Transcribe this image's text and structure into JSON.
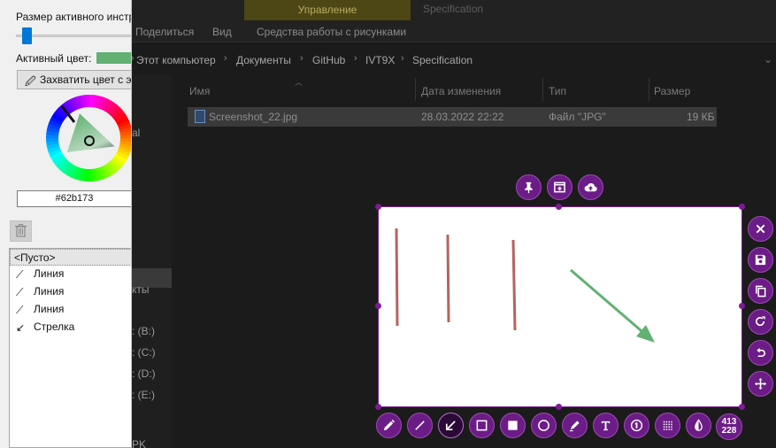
{
  "explorer": {
    "manage_tab": "Управление",
    "window_title": "Specification",
    "ribbon": {
      "share": "Поделиться",
      "view": "Вид",
      "picture_tools": "Средства работы с рисунками"
    },
    "breadcrumb": [
      "Этот компьютер",
      "Документы",
      "GitHub",
      "IVT9X",
      "Specification"
    ],
    "columns": {
      "name": "Имя",
      "date": "Дата изменения",
      "type": "Тип",
      "size": "Размер"
    },
    "file": {
      "name": "Screenshot_22.jpg",
      "date": "28.03.2022 22:22",
      "type": "Файл \"JPG\"",
      "size": "19 КБ"
    },
    "nav_fragments": [
      "al",
      "кты",
      ": (B:)",
      ": (C:)",
      ": (D:)",
      ": (E:)",
      "PK"
    ]
  },
  "panel": {
    "tool_size_label": "Размер активного инструмента",
    "active_color_label": "Активный цвет:",
    "active_color": "#62b173",
    "pick_button": "Захватить цвет с экрана",
    "hex_value": "#62b173",
    "history": [
      {
        "label": "<Пусто>",
        "icon": "none",
        "selected": true
      },
      {
        "label": "Линия",
        "icon": "line-icon"
      },
      {
        "label": "Линия",
        "icon": "line-icon"
      },
      {
        "label": "Линия",
        "icon": "line-icon"
      },
      {
        "label": "Стрелка",
        "icon": "arrow-icon"
      }
    ]
  },
  "capture": {
    "width": "413",
    "height": "228",
    "accent": "#6c1c86",
    "line_color": "#b5645e",
    "arrow_color": "#62b173"
  },
  "toolbar_top": [
    "pin-icon",
    "upload-window-icon",
    "cloud-upload-icon"
  ],
  "toolbar_side": [
    "close-icon",
    "save-icon",
    "copy-icon",
    "redo-icon",
    "undo-icon",
    "move-icon"
  ],
  "toolbar_bottom": [
    "pencil-icon",
    "line-icon",
    "arrow-icon",
    "rectangle-icon",
    "filled-rectangle-icon",
    "circle-icon",
    "marker-icon",
    "text-icon",
    "counter-icon",
    "pixelate-icon",
    "invert-icon"
  ]
}
